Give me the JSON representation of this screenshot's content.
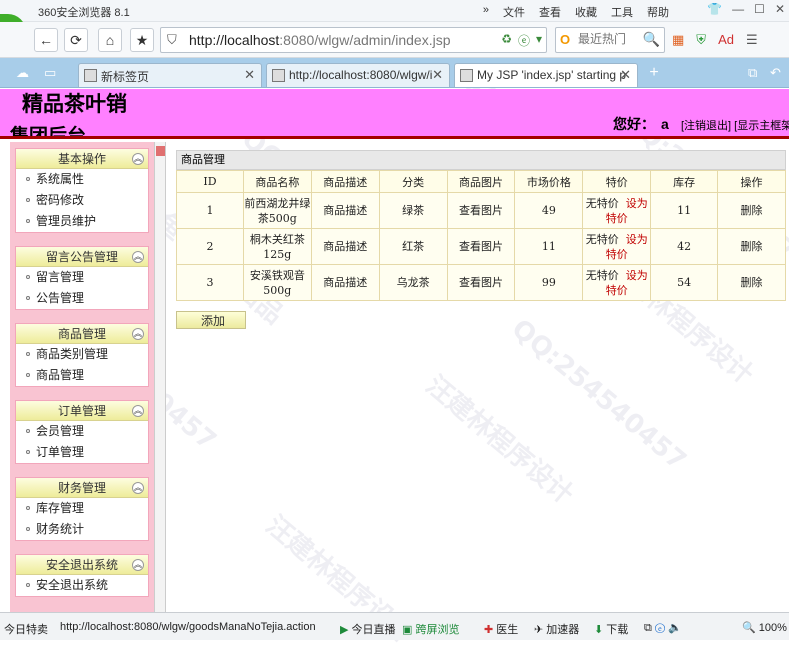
{
  "browser": {
    "app_title": "360安全浏览器 8.1",
    "menus": [
      "»",
      "文件",
      "查看",
      "收藏",
      "工具",
      "帮助"
    ],
    "url_host": "http://localhost",
    "url_rest": ":8080/wlgw/admin/index.jsp",
    "search_placeholder": "最近热门",
    "tabs": [
      {
        "label": "新标签页",
        "active": false
      },
      {
        "label": "http://localhost:8080/wlgw/i",
        "active": false
      },
      {
        "label": "My JSP 'index.jsp' starting p",
        "active": true
      }
    ]
  },
  "header": {
    "site_title": "精品茶叶销",
    "subtitle": "集团后台",
    "greeting": "您好：",
    "username": "a",
    "links": "[注销退出] [显示主框架"
  },
  "sidebar": {
    "menus": [
      {
        "title": "基本操作",
        "items": [
          "系统属性",
          "密码修改",
          "管理员维护"
        ]
      },
      {
        "title": "留言公告管理",
        "items": [
          "留言管理",
          "公告管理"
        ]
      },
      {
        "title": "商品管理",
        "items": [
          "商品类别管理",
          "商品管理"
        ]
      },
      {
        "title": "订单管理",
        "items": [
          "会员管理",
          "订单管理"
        ]
      },
      {
        "title": "财务管理",
        "items": [
          "库存管理",
          "财务统计"
        ]
      },
      {
        "title": "安全退出系统",
        "items": [
          "安全退出系统"
        ]
      }
    ]
  },
  "main": {
    "panel_title": "商品管理",
    "columns": [
      "ID",
      "商品名称",
      "商品描述",
      "分类",
      "商品图片",
      "市场价格",
      "特价",
      "库存",
      "操作"
    ],
    "rows": [
      {
        "id": "1",
        "name": "前西湖龙井绿茶500g",
        "desc": "商品描述",
        "category": "绿茶",
        "image": "查看图片",
        "price": "49",
        "special_status": "无特价",
        "special_action": "设为特价",
        "stock": "11",
        "op": "删除"
      },
      {
        "id": "2",
        "name": "桐木关红茶 125g",
        "desc": "商品描述",
        "category": "红茶",
        "image": "查看图片",
        "price": "11",
        "special_status": "无特价",
        "special_action": "设为特价",
        "stock": "42",
        "op": "删除"
      },
      {
        "id": "3",
        "name": "安溪铁观音500g",
        "desc": "商品描述",
        "category": "乌龙茶",
        "image": "查看图片",
        "price": "99",
        "special_status": "无特价",
        "special_action": "设为特价",
        "stock": "54",
        "op": "删除"
      }
    ],
    "add_button": "添加"
  },
  "statusbar": {
    "today": "今日特卖",
    "url": "http://localhost:8080/wlgw/goodsManaNoTejia.action",
    "live": "今日直播",
    "crossscreen": "跨屏浏览",
    "doctor": "医生",
    "accelerator": "加速器",
    "download": "下载",
    "zoom": "100%"
  },
  "watermarks": [
    "QQ:254540457",
    "汪建林程序设计",
    "汪建林源码出品",
    "双鱼林源码出品"
  ]
}
